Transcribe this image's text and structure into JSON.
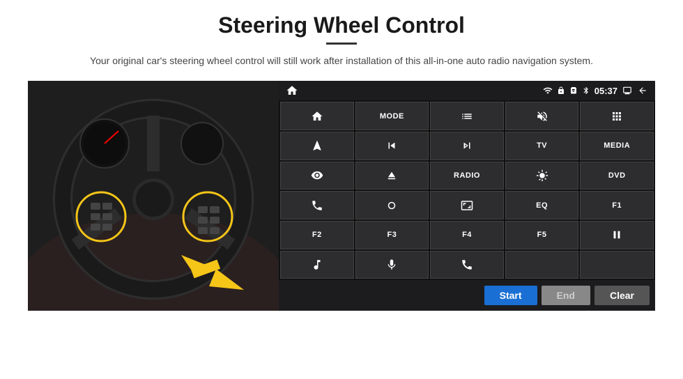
{
  "page": {
    "title": "Steering Wheel Control",
    "subtitle": "Your original car's steering wheel control will still work after installation of this all-in-one auto radio navigation system."
  },
  "status_bar": {
    "time": "05:37",
    "icons": [
      "wifi",
      "lock",
      "sim",
      "bluetooth",
      "screen",
      "back"
    ]
  },
  "buttons": [
    {
      "id": "home",
      "type": "icon",
      "icon": "home",
      "row": 1,
      "col": 1
    },
    {
      "id": "mode",
      "type": "text",
      "label": "MODE",
      "row": 1,
      "col": 2
    },
    {
      "id": "list",
      "type": "icon",
      "icon": "list",
      "row": 1,
      "col": 3
    },
    {
      "id": "mute",
      "type": "icon",
      "icon": "mute",
      "row": 1,
      "col": 4
    },
    {
      "id": "apps",
      "type": "icon",
      "icon": "apps",
      "row": 1,
      "col": 5
    },
    {
      "id": "nav",
      "type": "icon",
      "icon": "navigate",
      "row": 2,
      "col": 1
    },
    {
      "id": "prev",
      "type": "icon",
      "icon": "prev",
      "row": 2,
      "col": 2
    },
    {
      "id": "next",
      "type": "icon",
      "icon": "next",
      "row": 2,
      "col": 3
    },
    {
      "id": "tv",
      "type": "text",
      "label": "TV",
      "row": 2,
      "col": 4
    },
    {
      "id": "media",
      "type": "text",
      "label": "MEDIA",
      "row": 2,
      "col": 5
    },
    {
      "id": "cam360",
      "type": "icon",
      "icon": "360cam",
      "row": 3,
      "col": 1
    },
    {
      "id": "eject",
      "type": "icon",
      "icon": "eject",
      "row": 3,
      "col": 2
    },
    {
      "id": "radio",
      "type": "text",
      "label": "RADIO",
      "row": 3,
      "col": 3
    },
    {
      "id": "brightness",
      "type": "icon",
      "icon": "brightness",
      "row": 3,
      "col": 4
    },
    {
      "id": "dvd",
      "type": "text",
      "label": "DVD",
      "row": 3,
      "col": 5
    },
    {
      "id": "phone",
      "type": "icon",
      "icon": "phone",
      "row": 4,
      "col": 1
    },
    {
      "id": "swipe",
      "type": "icon",
      "icon": "swipe",
      "row": 4,
      "col": 2
    },
    {
      "id": "screen-fit",
      "type": "icon",
      "icon": "screenfit",
      "row": 4,
      "col": 3
    },
    {
      "id": "eq",
      "type": "text",
      "label": "EQ",
      "row": 4,
      "col": 4
    },
    {
      "id": "f1",
      "type": "text",
      "label": "F1",
      "row": 4,
      "col": 5
    },
    {
      "id": "f2",
      "type": "text",
      "label": "F2",
      "row": 5,
      "col": 1
    },
    {
      "id": "f3",
      "type": "text",
      "label": "F3",
      "row": 5,
      "col": 2
    },
    {
      "id": "f4",
      "type": "text",
      "label": "F4",
      "row": 5,
      "col": 3
    },
    {
      "id": "f5",
      "type": "text",
      "label": "F5",
      "row": 5,
      "col": 4
    },
    {
      "id": "playpause",
      "type": "icon",
      "icon": "playpause",
      "row": 5,
      "col": 5
    },
    {
      "id": "music",
      "type": "icon",
      "icon": "music",
      "row": 6,
      "col": 1
    },
    {
      "id": "mic",
      "type": "icon",
      "icon": "mic",
      "row": 6,
      "col": 2
    },
    {
      "id": "hangup",
      "type": "icon",
      "icon": "hangup",
      "row": 6,
      "col": 3
    },
    {
      "id": "empty1",
      "type": "text",
      "label": "",
      "row": 6,
      "col": 4
    },
    {
      "id": "empty2",
      "type": "text",
      "label": "",
      "row": 6,
      "col": 5
    }
  ],
  "action_buttons": {
    "start": "Start",
    "end": "End",
    "clear": "Clear"
  }
}
